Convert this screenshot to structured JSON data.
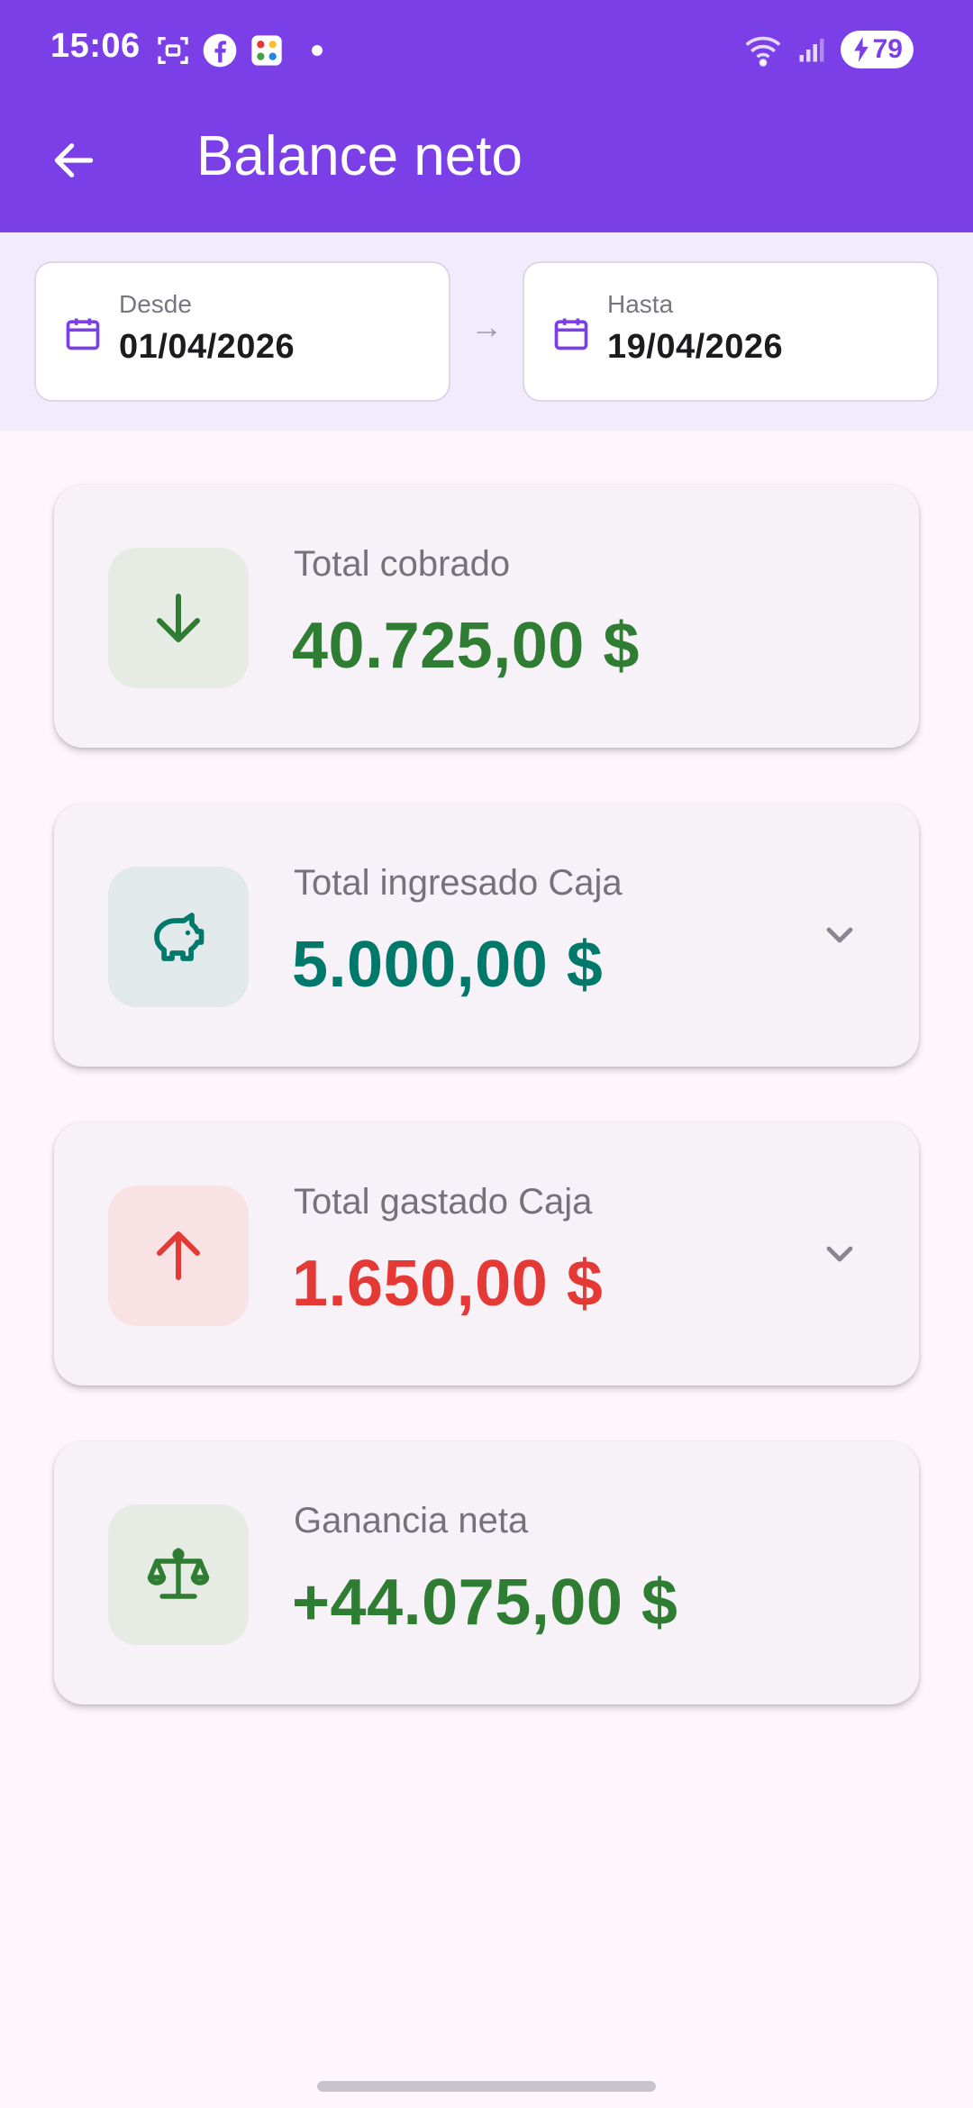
{
  "status_bar": {
    "time": "15:06",
    "battery": "79"
  },
  "app_bar": {
    "title": "Balance neto"
  },
  "date_range": {
    "from": {
      "label": "Desde",
      "value": "01/04/2026"
    },
    "to": {
      "label": "Hasta",
      "value": "19/04/2026"
    },
    "separator": "→"
  },
  "cards": [
    {
      "label": "Total cobrado",
      "value": "40.725,00 $",
      "icon": "arrow-down-icon",
      "color": "#2e7d32",
      "bg": "#e6ebe4"
    },
    {
      "label": "Total ingresado Caja",
      "value": "5.000,00 $",
      "icon": "piggy-bank-icon",
      "color": "#00796b",
      "bg": "#e1e9ea",
      "expandable": true
    },
    {
      "label": "Total gastado Caja",
      "value": "1.650,00 $",
      "icon": "arrow-up-icon",
      "color": "#e53935",
      "bg": "#f9e2e4",
      "expandable": true
    },
    {
      "label": "Ganancia neta",
      "value": "+44.075,00 $",
      "icon": "scale-icon",
      "color": "#2e7d32",
      "bg": "#e6ebe4"
    }
  ],
  "colors": {
    "primary": "#7b3fe8",
    "background": "#fdf7fd"
  }
}
